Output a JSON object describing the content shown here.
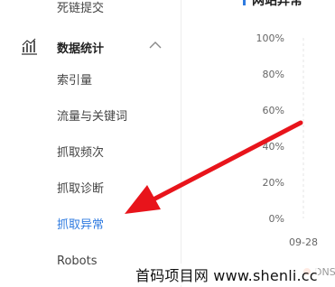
{
  "sidebar": {
    "top_item": "死链提交",
    "section": {
      "label": "数据统计",
      "icon": "bar-chart-icon",
      "expanded": true
    },
    "items": [
      {
        "label": "索引量",
        "active": false
      },
      {
        "label": "流量与关键词",
        "active": false
      },
      {
        "label": "抓取频次",
        "active": false
      },
      {
        "label": "抓取诊断",
        "active": false
      },
      {
        "label": "抓取异常",
        "active": true
      },
      {
        "label": "Robots",
        "active": false
      }
    ]
  },
  "main": {
    "chart_title": "网站异常"
  },
  "chart_data": {
    "type": "line",
    "title": "网站异常",
    "y_ticks": [
      "100%",
      "80%",
      "60%",
      "40%",
      "20%",
      "0%"
    ],
    "ylim": [
      0,
      100
    ],
    "x_ticks": [
      "09-28"
    ],
    "series": [
      {
        "name": "DNS",
        "color": "#ff7043"
      }
    ],
    "grid": true
  },
  "annotation": {
    "color": "#e8141b",
    "description": "red arrow pointing to 抓取异常"
  },
  "watermark": "首码项目网  www.shenli.cc",
  "colors": {
    "accent": "#2f7be0",
    "arrow": "#e8141b"
  }
}
